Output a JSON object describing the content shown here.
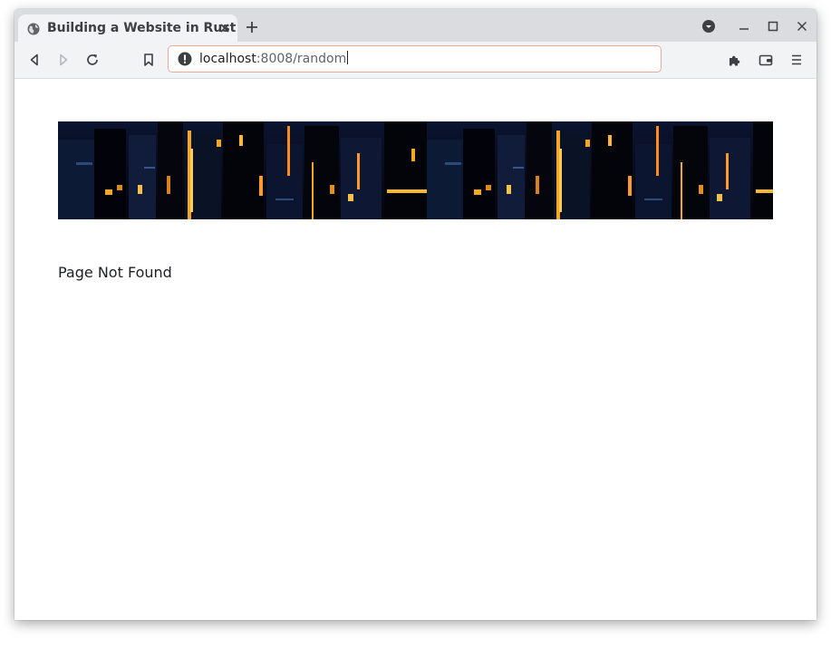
{
  "browser": {
    "tab": {
      "title": "Building a Website in Rust",
      "favicon": "globe-icon"
    },
    "address_bar": {
      "host": "localhost",
      "path": ":8008/random",
      "security_icon": "info-icon"
    },
    "toolbar_icons": [
      "back-icon",
      "forward-icon",
      "reload-icon",
      "bookmark-icon",
      "extensions-icon",
      "wallet-icon",
      "menu-icon"
    ],
    "window_controls": [
      "tab-search-icon",
      "minimize-icon",
      "maximize-icon",
      "close-icon"
    ]
  },
  "page": {
    "banner_image": "city-night-banner",
    "message": "Page Not Found"
  },
  "colors": {
    "tab_strip": "#dadcdf",
    "toolbar": "#f1f3f4",
    "omnibox_border": "#f2a899",
    "banner_dark": "#06070f",
    "banner_light": "#f5a623"
  }
}
